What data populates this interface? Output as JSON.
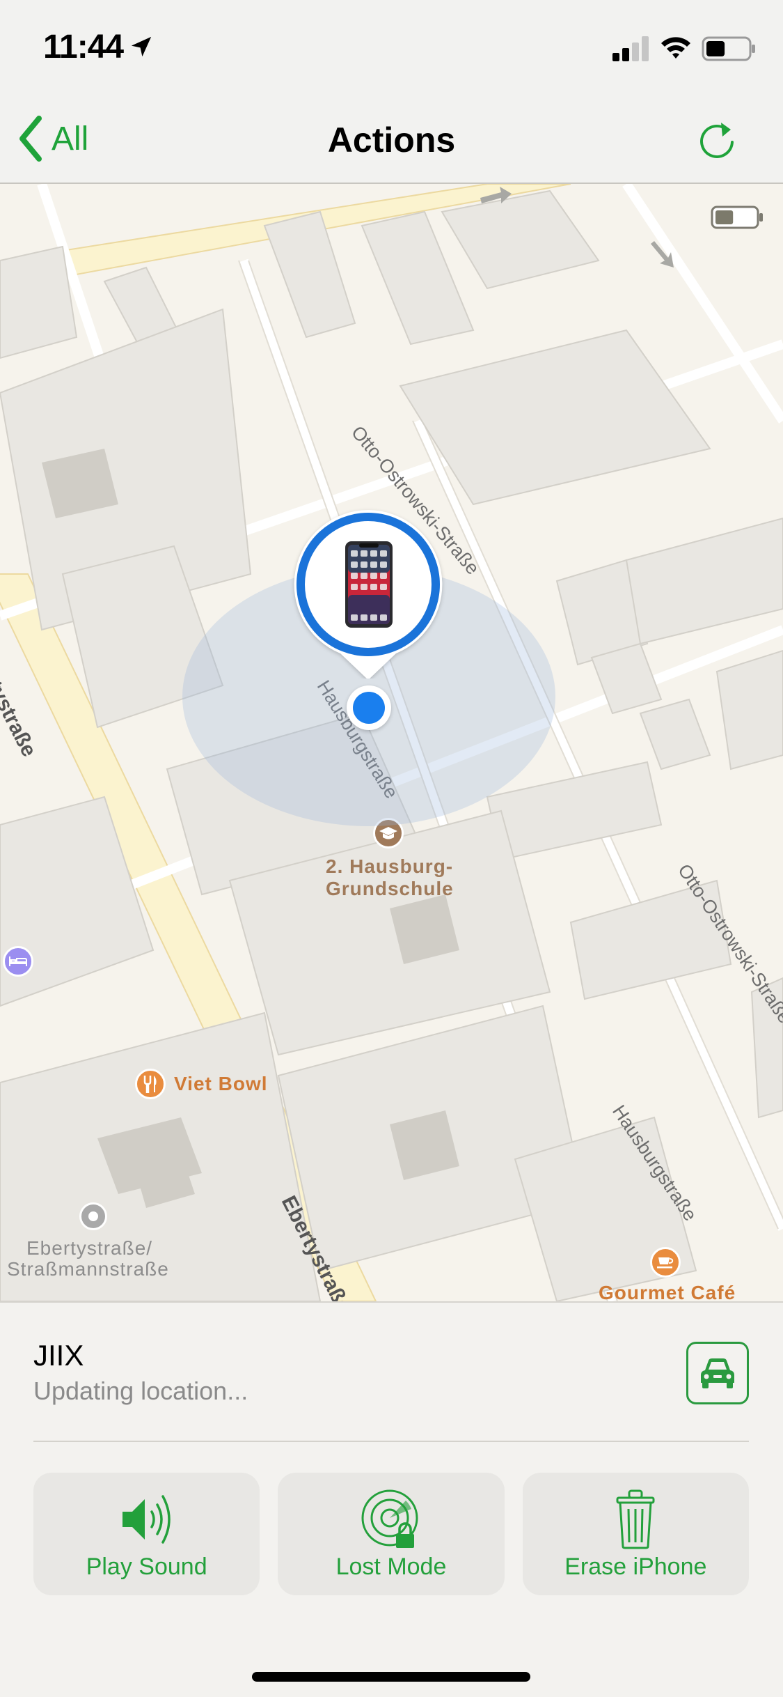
{
  "status_bar": {
    "time": "11:44",
    "icons": [
      "location-arrow-icon",
      "cellular-signal-icon",
      "wifi-icon",
      "battery-icon"
    ],
    "signal_bars_active": 2,
    "signal_bars_total": 4,
    "battery_level": 0.45
  },
  "nav": {
    "back_label": "All",
    "title": "Actions",
    "back_icon": "chevron-left-icon",
    "refresh_icon": "refresh-icon"
  },
  "colors": {
    "accent_green": "#23a03b",
    "location_blue": "#1a7fee",
    "poi_orange": "#e98c3e",
    "poi_school_brown": "#a07a5a",
    "poi_hotel_purple": "#9b8ef0"
  },
  "map": {
    "device_battery_level": 0.45,
    "streets": [
      {
        "name": "Otto-Ostrowski-Straße"
      },
      {
        "name": "Hausburgstraße"
      },
      {
        "name": "Ebertystraße"
      },
      {
        "name": "Ebertystraße"
      },
      {
        "name": "Otto-Ostrowski-Straße"
      },
      {
        "name": "Hausburgstraße"
      }
    ],
    "pois": [
      {
        "name": "2. Hausburg-",
        "name2": "Grundschule",
        "icon": "school-icon"
      },
      {
        "name": "Viet Bowl",
        "icon": "restaurant-icon"
      },
      {
        "name": "Ebertystraße/",
        "name2": "Straßmannstraße",
        "icon": "transit-stop-icon"
      },
      {
        "name": "Gourmet Café",
        "icon": "cafe-icon"
      },
      {
        "name": "",
        "icon": "hotel-icon"
      }
    ],
    "device_icon": "iphone-icon"
  },
  "device": {
    "name": "JIIX",
    "status": "Updating location...",
    "directions_icon": "car-icon"
  },
  "actions": [
    {
      "label": "Play Sound",
      "icon": "speaker-icon"
    },
    {
      "label": "Lost Mode",
      "icon": "lost-mode-radar-lock-icon"
    },
    {
      "label": "Erase iPhone",
      "icon": "trash-icon"
    }
  ]
}
